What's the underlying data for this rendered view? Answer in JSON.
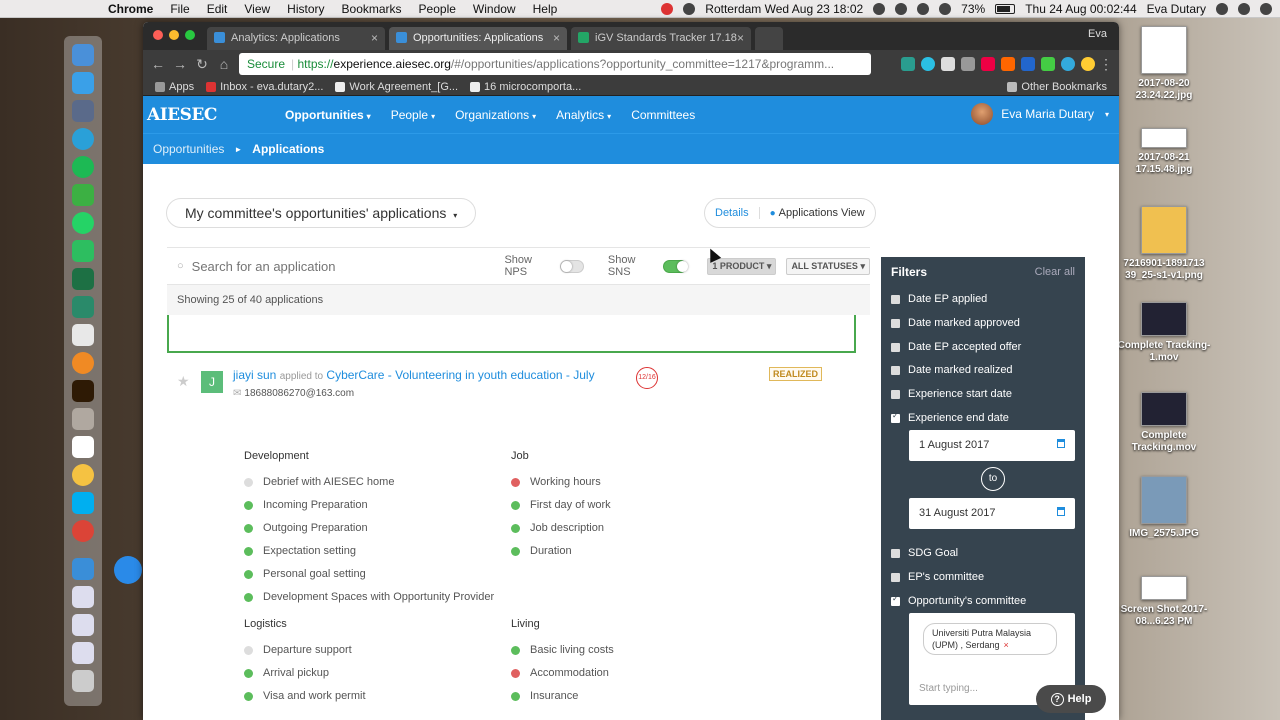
{
  "menubar": {
    "app": "Chrome",
    "items": [
      "File",
      "Edit",
      "View",
      "History",
      "Bookmarks",
      "People",
      "Window",
      "Help"
    ],
    "location": "Rotterdam Wed Aug 23 18:02",
    "battery": "73%",
    "datetime": "Thu 24 Aug  00:02:44",
    "user": "Eva Dutary"
  },
  "browser": {
    "tabs": [
      {
        "label": "Analytics: Applications",
        "close": "×"
      },
      {
        "label": "Opportunities: Applications",
        "close": "×"
      },
      {
        "label": "iGV Standards Tracker 17.18",
        "close": "×"
      }
    ],
    "profile": "Eva",
    "secure_label": "Secure",
    "url_prefix": "https://",
    "url_host": "experience.aiesec.org",
    "url_rest": "/#/opportunities/applications?opportunity_committee=1217&programm...",
    "bookmarks": [
      "Apps",
      "Inbox - eva.dutary2...",
      "Work Agreement_[G...",
      "16 microcomporta..."
    ],
    "other_bookmarks": "Other Bookmarks"
  },
  "header": {
    "logo": "AIESEC",
    "nav": [
      {
        "label": "Opportunities",
        "caret": "▾"
      },
      {
        "label": "People",
        "caret": "▾"
      },
      {
        "label": "Organizations",
        "caret": "▾"
      },
      {
        "label": "Analytics",
        "caret": "▾"
      },
      {
        "label": "Committees",
        "caret": ""
      }
    ],
    "user_name": "Eva Maria Dutary",
    "user_caret": "▾"
  },
  "breadcrumb": {
    "parent": "Opportunities",
    "sep": "►",
    "current": "Applications"
  },
  "page": {
    "scope_select": "My committee's opportunities' applications",
    "scope_caret": "▾",
    "view_details": "Details",
    "view_applications": "Applications View",
    "search_placeholder": "Search for an application",
    "show_nps": "Show NPS",
    "show_nps_on": false,
    "show_sns": "Show SNS",
    "show_sns_on": true,
    "product_btn": "1 PRODUCT ▾",
    "status_btn": "ALL STATUSES ▾",
    "showing": "Showing 25 of 40 applications"
  },
  "application": {
    "initial": "J",
    "name": "jiayi sun",
    "applied_to": "applied to",
    "opportunity": "CyberCare - Volunteering in youth education - July",
    "email": "18688086270@163.com",
    "count": "12/16",
    "status": "REALIZED",
    "sections": [
      {
        "title": "Development",
        "items": [
          {
            "label": "Debrief with AIESEC home",
            "state": "none"
          },
          {
            "label": "Incoming Preparation",
            "state": "ok"
          },
          {
            "label": "Outgoing Preparation",
            "state": "ok"
          },
          {
            "label": "Expectation setting",
            "state": "ok"
          },
          {
            "label": "Personal goal setting",
            "state": "ok"
          },
          {
            "label": "Development Spaces with Opportunity Provider",
            "state": "ok"
          }
        ]
      },
      {
        "title": "Job",
        "items": [
          {
            "label": "Working hours",
            "state": "bad"
          },
          {
            "label": "First day of work",
            "state": "ok"
          },
          {
            "label": "Job description",
            "state": "ok"
          },
          {
            "label": "Duration",
            "state": "ok"
          }
        ]
      },
      {
        "title": "Logistics",
        "items": [
          {
            "label": "Departure support",
            "state": "none"
          },
          {
            "label": "Arrival pickup",
            "state": "ok"
          },
          {
            "label": "Visa and work permit",
            "state": "ok"
          }
        ]
      },
      {
        "title": "Living",
        "items": [
          {
            "label": "Basic living costs",
            "state": "ok"
          },
          {
            "label": "Accommodation",
            "state": "bad"
          },
          {
            "label": "Insurance",
            "state": "ok"
          }
        ]
      }
    ]
  },
  "filters": {
    "title": "Filters",
    "clear_all": "Clear all",
    "items": [
      {
        "label": "Date EP applied",
        "checked": false
      },
      {
        "label": "Date marked approved",
        "checked": false
      },
      {
        "label": "Date EP accepted offer",
        "checked": false
      },
      {
        "label": "Date marked realized",
        "checked": false
      },
      {
        "label": "Experience start date",
        "checked": false
      },
      {
        "label": "Experience end date",
        "checked": true
      },
      {
        "label": "SDG Goal",
        "checked": false
      },
      {
        "label": "EP's committee",
        "checked": false
      },
      {
        "label": "Opportunity's committee",
        "checked": true
      }
    ],
    "date_from": "1 August 2017",
    "date_to_label": "to",
    "date_to": "31 August 2017",
    "committee_tag": "Universiti Putra Malaysia (UPM) , Serdang",
    "tag_remove": "×",
    "typing_placeholder": "Start typing...",
    "help": "Help",
    "help_glyph": "?"
  },
  "desktop": {
    "files": [
      "2017-08-20 23.24.22.jpg",
      "2017-08-21 17.15.48.jpg",
      "7216901-1891713 39_25-s1-v1.png",
      "Complete Tracking-1.mov",
      "Complete Tracking.mov",
      "IMG_2575.JPG",
      "Screen Shot 2017-08...6.23 PM"
    ]
  },
  "colors": {
    "brand": "#1f8ddd",
    "ok": "#5cbd5c",
    "bad": "#e06060",
    "realized": "#c08a1f",
    "filters_bg": "#36444f"
  }
}
